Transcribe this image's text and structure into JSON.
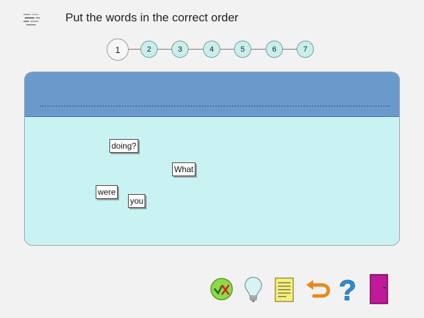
{
  "header": {
    "title": "Put the words in the correct order"
  },
  "steps": {
    "items": [
      "1",
      "2",
      "3",
      "4",
      "5",
      "6",
      "7"
    ],
    "active_index": 0
  },
  "words": {
    "doing": "doing?",
    "what": "What",
    "were": "were",
    "you": "you"
  },
  "icons": {
    "app": "list-order-icon",
    "check": "check-answer-icon",
    "hint": "lightbulb-icon",
    "notes": "notes-icon",
    "undo": "undo-icon",
    "help": "help-icon",
    "exit": "exit-door-icon"
  },
  "colors": {
    "answer_area": "#6a9acb",
    "board": "#c9f2f2",
    "step": "#c8eeee",
    "exit": "#c0199a",
    "help": "#2a8fd6"
  }
}
